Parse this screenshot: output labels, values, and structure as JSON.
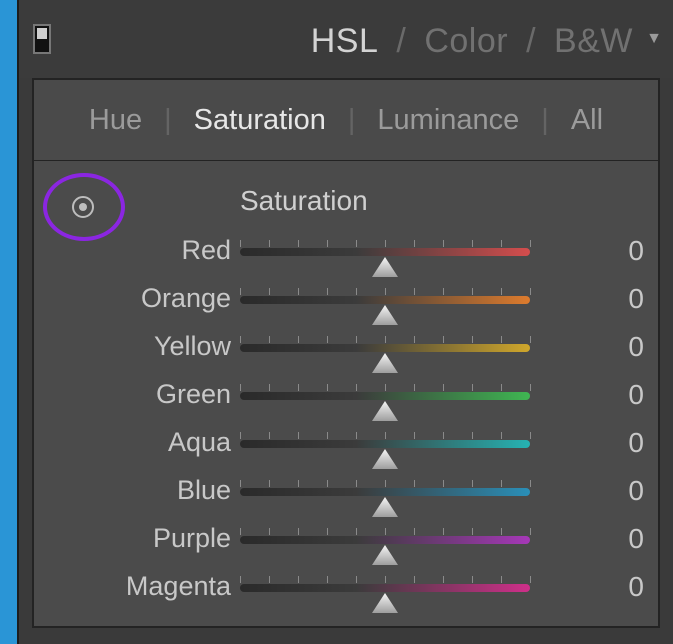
{
  "header": {
    "modes": [
      "HSL",
      "Color",
      "B&W"
    ],
    "active_mode": "HSL",
    "separator": "/",
    "toggle_icon": "panel-toggle-icon",
    "collapse_icon": "collapse-triangle-icon"
  },
  "tabs": {
    "items": [
      "Hue",
      "Saturation",
      "Luminance",
      "All"
    ],
    "active": "Saturation",
    "separator": "|"
  },
  "panel": {
    "title": "Saturation",
    "target_icon": "targeted-adjustment-icon",
    "highlight_color": "#8b26e2",
    "sliders": [
      {
        "label": "Red",
        "value": "0",
        "color": "#d44d4d"
      },
      {
        "label": "Orange",
        "value": "0",
        "color": "#dd7b2d"
      },
      {
        "label": "Yellow",
        "value": "0",
        "color": "#d0a72b"
      },
      {
        "label": "Green",
        "value": "0",
        "color": "#3fb652"
      },
      {
        "label": "Aqua",
        "value": "0",
        "color": "#26b3b3"
      },
      {
        "label": "Blue",
        "value": "0",
        "color": "#2a8fb8"
      },
      {
        "label": "Purple",
        "value": "0",
        "color": "#a638b8"
      },
      {
        "label": "Magenta",
        "value": "0",
        "color": "#cf2f8a"
      }
    ]
  }
}
